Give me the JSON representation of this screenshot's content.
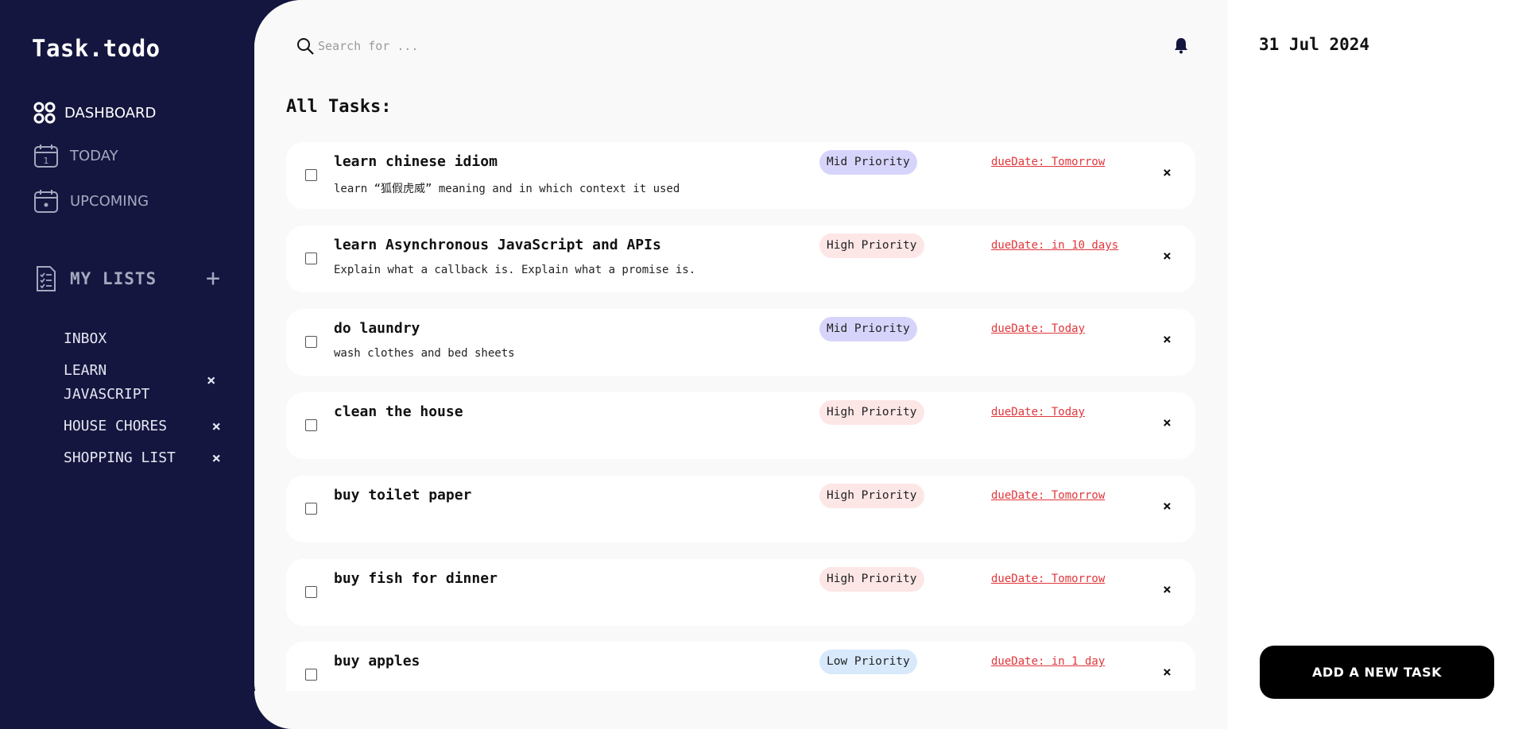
{
  "app": {
    "logo": "Task.todo"
  },
  "nav": [
    {
      "label": "DASHBOARD",
      "icon": "dashboard-icon",
      "active": true
    },
    {
      "label": "TODAY",
      "icon": "calendar-day-icon",
      "calendar_day": "1",
      "active": false
    },
    {
      "label": "UPCOMING",
      "icon": "calendar-icon",
      "active": false
    }
  ],
  "my_lists": {
    "label": "MY LISTS",
    "add_label": "+",
    "items": [
      {
        "label": "INBOX",
        "deletable": false
      },
      {
        "label": "LEARN JAVASCRIPT",
        "deletable": true
      },
      {
        "label": "HOUSE CHORES",
        "deletable": true
      },
      {
        "label": "SHOPPING LIST",
        "deletable": true
      }
    ],
    "delete_label": "×"
  },
  "search": {
    "placeholder": "Search for ..."
  },
  "section_title": "All Tasks:",
  "tasks": [
    {
      "title": "learn chinese idiom",
      "desc": "learn “狐假虎威” meaning and in which context it used",
      "priority": "Mid Priority",
      "priority_level": "mid",
      "due": "dueDate: Tomorrow"
    },
    {
      "title": "learn Asynchronous JavaScript and APIs",
      "desc": "Explain what a callback is. Explain what a promise is.",
      "priority": "High Priority",
      "priority_level": "high",
      "due": "dueDate: in 10 days"
    },
    {
      "title": "do laundry",
      "desc": "wash clothes and bed sheets",
      "priority": "Mid Priority",
      "priority_level": "mid",
      "due": "dueDate: Today"
    },
    {
      "title": "clean the house",
      "desc": "",
      "priority": "High Priority",
      "priority_level": "high",
      "due": "dueDate: Today"
    },
    {
      "title": "buy toilet paper",
      "desc": "",
      "priority": "High Priority",
      "priority_level": "high",
      "due": "dueDate: Tomorrow"
    },
    {
      "title": "buy fish for dinner",
      "desc": "",
      "priority": "High Priority",
      "priority_level": "high",
      "due": "dueDate: Tomorrow"
    },
    {
      "title": "buy apples",
      "desc": "",
      "priority": "Low Priority",
      "priority_level": "low",
      "due": "dueDate: in 1 day"
    }
  ],
  "task_delete_label": "×",
  "date": "31 Jul 2024",
  "add_task_label": "ADD A NEW TASK",
  "colors": {
    "sidebar_bg": "#14163f",
    "due_red": "#e0363a",
    "mid_priority": "#d7d4fb",
    "high_priority": "#fde6e6",
    "low_priority": "#d7e9fb"
  }
}
